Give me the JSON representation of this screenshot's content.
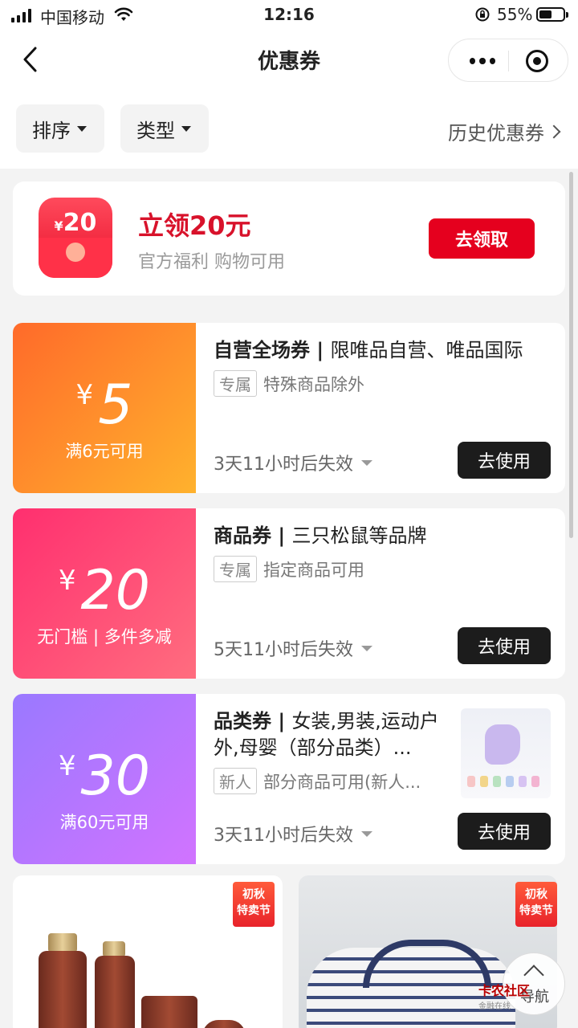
{
  "status_bar": {
    "carrier": "中国移动",
    "time": "12:16",
    "battery": "55%",
    "battery_level": 0.55
  },
  "nav": {
    "title": "优惠券",
    "icons": [
      "back-icon",
      "more-icon",
      "target-icon"
    ]
  },
  "filters": {
    "sort_label": "排序",
    "type_label": "类型",
    "history_label": "历史优惠券"
  },
  "promo": {
    "badge_amount": "20",
    "badge_currency": "¥",
    "title": "立领20元",
    "subtitle": "官方福利 购物可用",
    "button": "去领取"
  },
  "coupons": [
    {
      "currency": "¥",
      "amount": "5",
      "condition": "满6元可用",
      "type": "自营全场券",
      "scope": "限唯品自营、唯品国际",
      "tag": "专属",
      "note": "特殊商品除外",
      "expire": "3天11小时后失效",
      "button": "去使用",
      "colors": [
        "#ff6a2a",
        "#ffb22d"
      ]
    },
    {
      "currency": "¥",
      "amount": "20",
      "condition": "无门槛 | 多件多减",
      "type": "商品券",
      "scope": "三只松鼠等品牌",
      "tag": "专属",
      "note": "指定商品可用",
      "expire": "5天11小时后失效",
      "button": "去使用",
      "colors": [
        "#ff2f6f",
        "#ff6d7f"
      ]
    },
    {
      "currency": "¥",
      "amount": "30",
      "condition": "满60元可用",
      "type": "品类券",
      "scope": "女装,男装,运动户外,母婴（部分品类）...",
      "tag": "新人",
      "note": "部分商品可用(新人...",
      "expire": "3天11小时后失效",
      "button": "去使用",
      "colors": [
        "#9a79ff",
        "#d173ff"
      ]
    }
  ],
  "products": [
    {
      "badge_line1": "初秋",
      "badge_line2": "特卖节"
    },
    {
      "badge_line1": "初秋",
      "badge_line2": "特卖节"
    }
  ],
  "float_nav": {
    "label": "导航"
  },
  "watermark": {
    "name": "卡农社区",
    "slogan": "金融在线"
  }
}
